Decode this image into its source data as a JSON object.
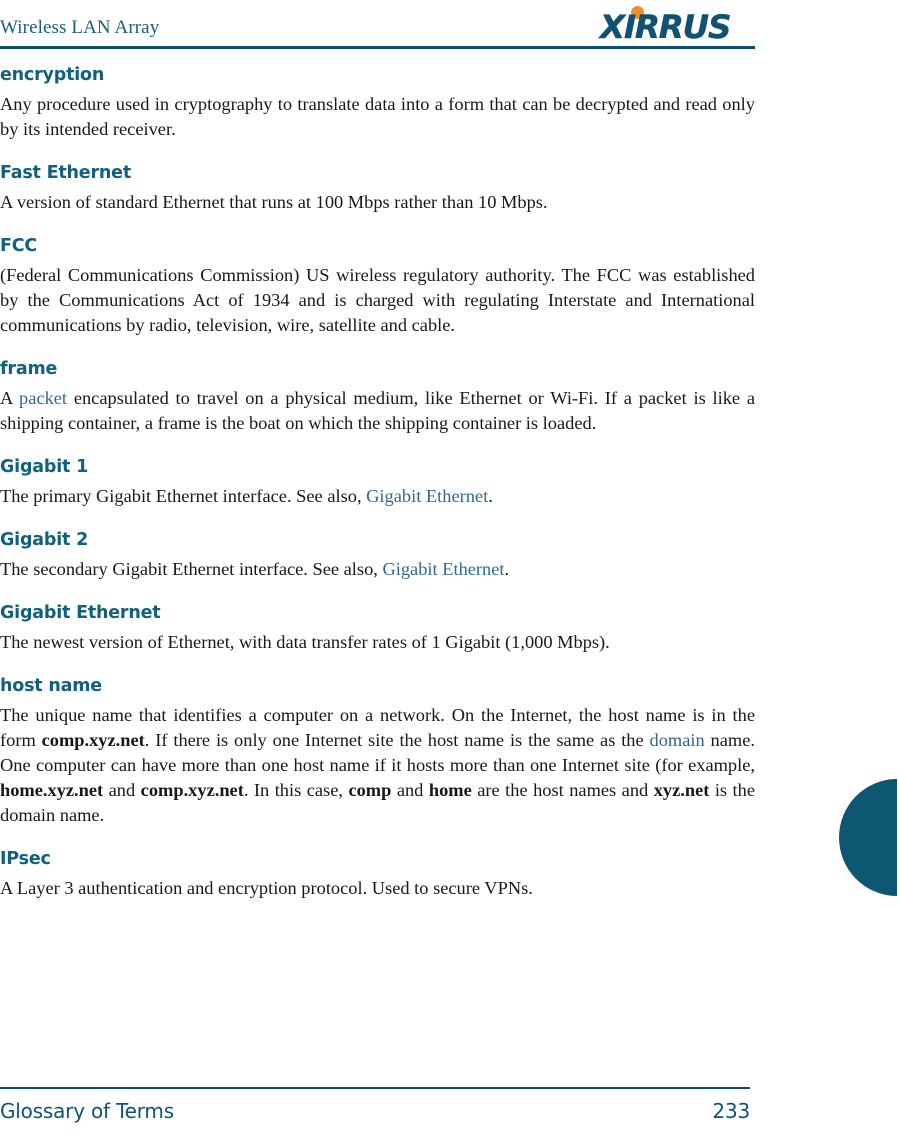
{
  "header": {
    "title": "Wireless LAN Array",
    "logo_text": "XIRRUS",
    "logo_color": "#115272",
    "logo_dot_color": "#f28b31",
    "rule_color": "#0a4f6b"
  },
  "theme": {
    "heading_color": "#11607f",
    "link_color": "#2d6a8a",
    "body_color": "#17181a",
    "tab_color": "#0e5773",
    "footer_color": "#0d5572"
  },
  "glossary": {
    "entries": [
      {
        "term": "encryption",
        "parts": [
          {
            "type": "text",
            "text": "Any procedure used in cryptography to translate data into a form that can be decrypted and read only by its intended receiver."
          }
        ]
      },
      {
        "term": "Fast Ethernet",
        "parts": [
          {
            "type": "text",
            "text": "A version of standard Ethernet that runs at 100 Mbps rather than 10 Mbps."
          }
        ]
      },
      {
        "term": "FCC",
        "parts": [
          {
            "type": "text",
            "text": "(Federal Communications Commission) US wireless regulatory authority. The FCC was established by the Communications Act of 1934 and is charged with regulating Interstate and International communications by radio, television, wire, satellite and cable."
          }
        ]
      },
      {
        "term": "frame",
        "parts": [
          {
            "type": "text",
            "text": "A "
          },
          {
            "type": "link",
            "text": "packet"
          },
          {
            "type": "text",
            "text": " encapsulated to travel on a physical medium, like Ethernet or Wi-Fi. If a packet is like a shipping container, a frame is the boat on which the shipping container is loaded."
          }
        ]
      },
      {
        "term": "Gigabit 1",
        "parts": [
          {
            "type": "text",
            "text": "The primary Gigabit Ethernet interface. See also, "
          },
          {
            "type": "link",
            "text": "Gigabit Ethernet"
          },
          {
            "type": "text",
            "text": "."
          }
        ]
      },
      {
        "term": "Gigabit 2",
        "parts": [
          {
            "type": "text",
            "text": "The secondary Gigabit Ethernet interface. See also, "
          },
          {
            "type": "link",
            "text": "Gigabit Ethernet"
          },
          {
            "type": "text",
            "text": "."
          }
        ]
      },
      {
        "term": "Gigabit Ethernet",
        "parts": [
          {
            "type": "text",
            "text": "The newest version of Ethernet, with data transfer rates of 1 Gigabit (1,000 Mbps)."
          }
        ]
      },
      {
        "term": "host name",
        "parts": [
          {
            "type": "text",
            "text": "The unique name that identifies a computer on a network. On the Internet, the host name is in the form "
          },
          {
            "type": "bold",
            "text": "comp.xyz.net"
          },
          {
            "type": "text",
            "text": ". If there is only one Internet site the host name is the same as the "
          },
          {
            "type": "link",
            "text": "domain"
          },
          {
            "type": "text",
            "text": " name. One computer can have more than one host name if it hosts more than one Internet site (for example, "
          },
          {
            "type": "bold",
            "text": "home.xyz.net"
          },
          {
            "type": "text",
            "text": " and "
          },
          {
            "type": "bold",
            "text": "comp.xyz.net"
          },
          {
            "type": "text",
            "text": ". In this case, "
          },
          {
            "type": "bold",
            "text": "comp"
          },
          {
            "type": "text",
            "text": " and "
          },
          {
            "type": "bold",
            "text": "home"
          },
          {
            "type": "text",
            "text": " are the host names and "
          },
          {
            "type": "bold",
            "text": "xyz.net"
          },
          {
            "type": "text",
            "text": " is the domain name."
          }
        ]
      },
      {
        "term": "IPsec",
        "parts": [
          {
            "type": "text",
            "text": "A Layer 3 authentication and encryption protocol. Used to secure VPNs."
          }
        ]
      }
    ]
  },
  "footer": {
    "section_label": "Glossary of Terms",
    "page_number": "233"
  }
}
